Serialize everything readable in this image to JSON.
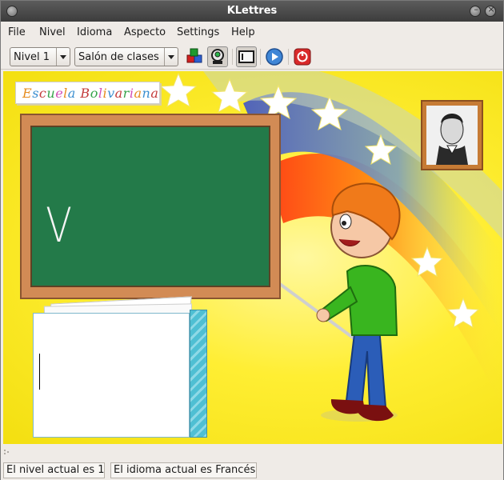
{
  "window": {
    "title": "KLettres"
  },
  "menubar": {
    "items": [
      {
        "id": "file",
        "label": "File"
      },
      {
        "id": "nivel",
        "label": "Nivel"
      },
      {
        "id": "idioma",
        "label": "Idioma"
      },
      {
        "id": "aspecto",
        "label": "Aspecto"
      },
      {
        "id": "settings",
        "label": "Settings"
      },
      {
        "id": "help",
        "label": "Help"
      }
    ]
  },
  "toolbar": {
    "level_combo": {
      "selected": "Nivel 1"
    },
    "theme_combo": {
      "selected": "Salón de clases"
    },
    "buttons": [
      {
        "icon": "cubes-icon",
        "pressed": false
      },
      {
        "icon": "grownup-icon",
        "pressed": true
      },
      {
        "icon": "menubar-toggle-icon",
        "pressed": false
      },
      {
        "icon": "play-icon",
        "pressed": false
      },
      {
        "icon": "quit-icon",
        "pressed": false
      }
    ]
  },
  "canvas": {
    "banner_text": "Escuela Bolivariana",
    "banner_colors": [
      "#e58b1d",
      "#3b8fd0",
      "#c33a3a",
      "#35a34a",
      "#d34fb7"
    ],
    "chalkboard_letter": "V",
    "input_value": ""
  },
  "statusbar": {
    "level_text": "El nivel actual es 1",
    "language_text": "El idioma actual es Francés"
  }
}
